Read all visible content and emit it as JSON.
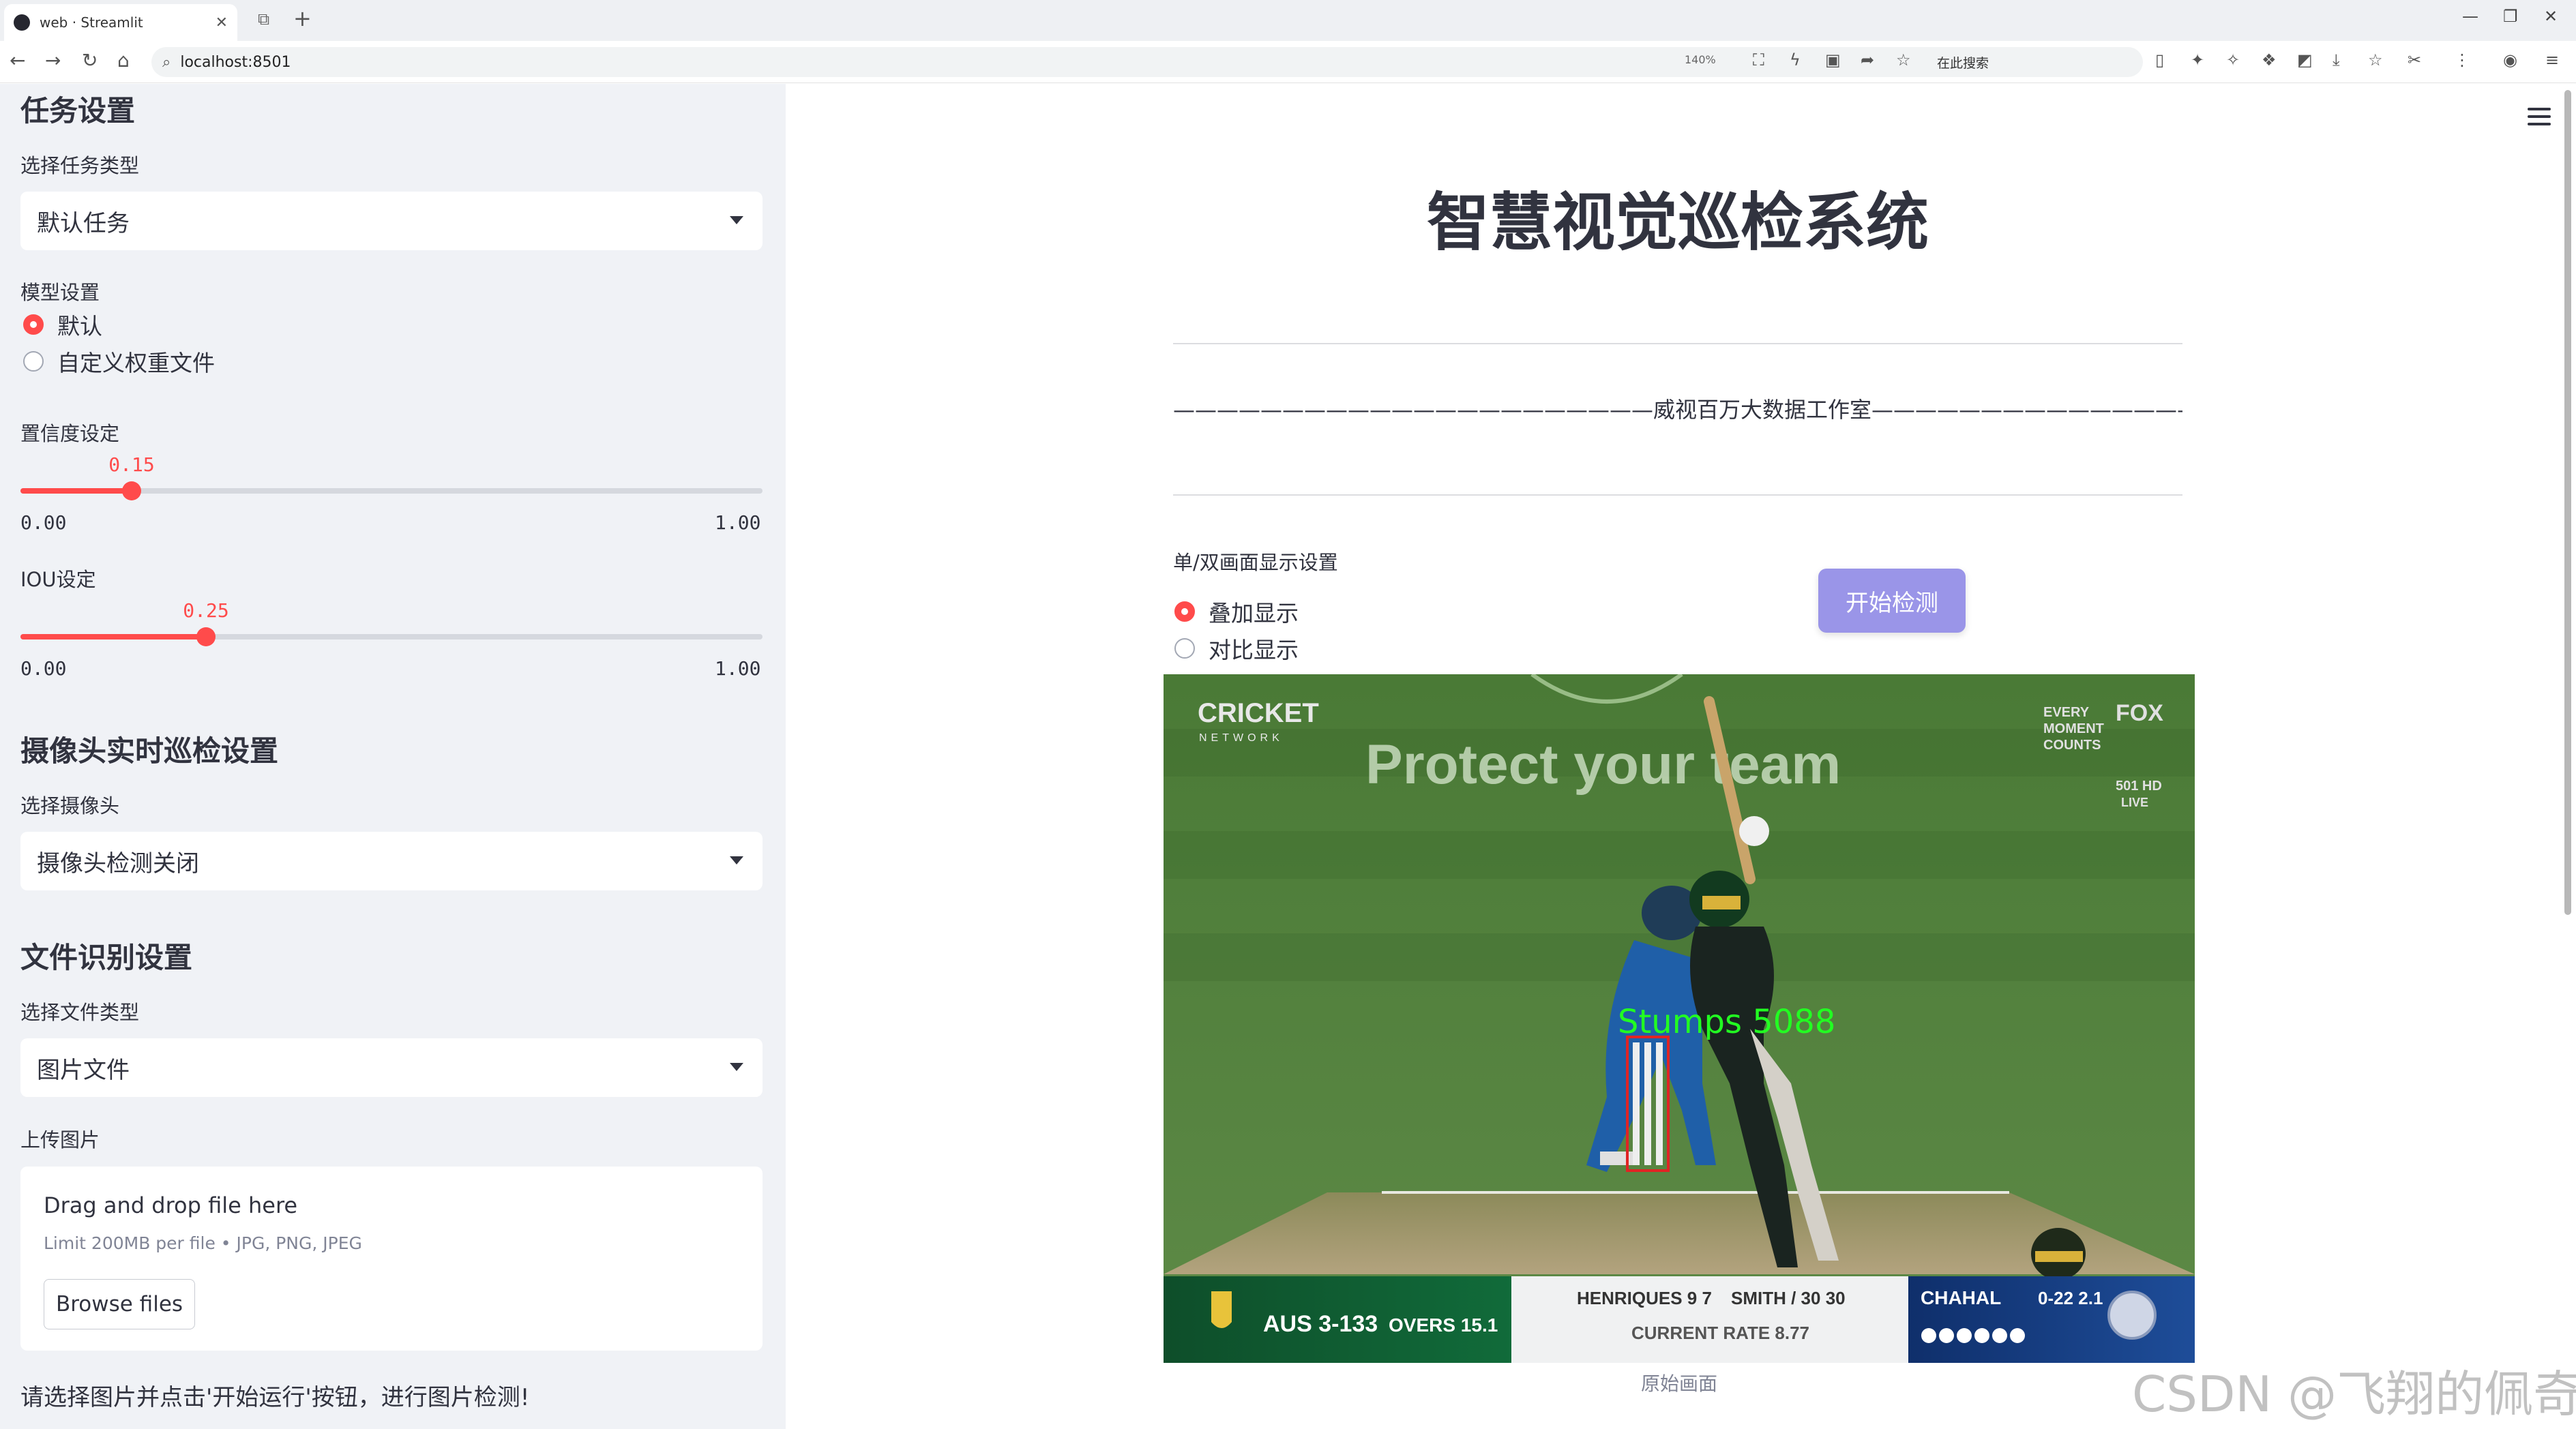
{
  "browser": {
    "tab_title": "web · Streamlit",
    "url": "localhost:8501",
    "zoom": "140%",
    "search_engine": "在此搜索"
  },
  "sidebar": {
    "task_heading": "任务设置",
    "task_type_label": "选择任务类型",
    "task_type_value": "默认任务",
    "model_label": "模型设置",
    "model_options": [
      "默认",
      "自定义权重文件"
    ],
    "model_selected": "默认",
    "conf_label": "置信度设定",
    "conf_value": "0.15",
    "conf_min": "0.00",
    "conf_max": "1.00",
    "iou_label": "IOU设定",
    "iou_value": "0.25",
    "iou_min": "0.00",
    "iou_max": "1.00",
    "camera_heading": "摄像头实时巡检设置",
    "camera_label": "选择摄像头",
    "camera_value": "摄像头检测关闭",
    "file_heading": "文件识别设置",
    "file_type_label": "选择文件类型",
    "file_type_value": "图片文件",
    "upload_label": "上传图片",
    "upload_drag": "Drag and drop file here",
    "upload_limit": "Limit 200MB per file • JPG, PNG, JPEG",
    "browse_button": "Browse files",
    "hint": "请选择图片并点击'开始运行'按钮，进行图片检测!"
  },
  "main": {
    "title": "智慧视觉巡检系统",
    "studio_line": "——————————————————————威视百万大数据工作室——————————————————————",
    "display_label": "单/双画面显示设置",
    "display_options": [
      "叠加显示",
      "对比显示"
    ],
    "display_selected": "叠加显示",
    "start_button": "开始检测",
    "image_caption": "原始画面",
    "watermark": "CSDN @飞翔的佩奇"
  },
  "scene": {
    "banner_text": "Protect your team",
    "broadcaster_logo": "CRICKET",
    "broadcaster_sub": "NETWORK",
    "corner_text_1": "EVERY",
    "corner_text_2": "MOMENT",
    "corner_text_3": "COUNTS",
    "corner_brand": "FOX",
    "corner_channel": "501 HD",
    "corner_live": "LIVE",
    "detection_label": "Stumps  5088",
    "score_team": "AUS 3-133",
    "score_overs": "OVERS 15.1",
    "batter_1": "HENRIQUES  9 7",
    "batter_2": "SMITH / 30 30",
    "run_rate": "CURRENT RATE 8.77",
    "bowler": "CHAHAL",
    "bowler_fig": "0-22 2.1",
    "colors": {
      "detection": "#22ff22",
      "box": "#e02424",
      "grass": "#4f7a3b"
    }
  }
}
